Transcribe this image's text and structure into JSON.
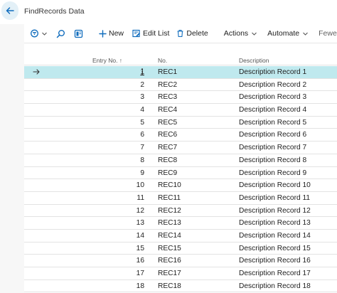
{
  "page": {
    "title": "FindRecords Data"
  },
  "toolbar": {
    "new_label": "New",
    "edit_list_label": "Edit List",
    "delete_label": "Delete",
    "actions_label": "Actions",
    "automate_label": "Automate",
    "fewer_options_label": "Fewer options"
  },
  "table": {
    "headers": {
      "entry_no": "Entry No. ↑",
      "no": "No.",
      "description": "Description"
    },
    "rows": [
      {
        "entry": "1",
        "no": "REC1",
        "desc": "Description Record 1"
      },
      {
        "entry": "2",
        "no": "REC2",
        "desc": "Description Record 2"
      },
      {
        "entry": "3",
        "no": "REC3",
        "desc": "Description Record 3"
      },
      {
        "entry": "4",
        "no": "REC4",
        "desc": "Description Record 4"
      },
      {
        "entry": "5",
        "no": "REC5",
        "desc": "Description Record 5"
      },
      {
        "entry": "6",
        "no": "REC6",
        "desc": "Description Record 6"
      },
      {
        "entry": "7",
        "no": "REC7",
        "desc": "Description Record 7"
      },
      {
        "entry": "8",
        "no": "REC8",
        "desc": "Description Record 8"
      },
      {
        "entry": "9",
        "no": "REC9",
        "desc": "Description Record 9"
      },
      {
        "entry": "10",
        "no": "REC10",
        "desc": "Description Record 10"
      },
      {
        "entry": "11",
        "no": "REC11",
        "desc": "Description Record 11"
      },
      {
        "entry": "12",
        "no": "REC12",
        "desc": "Description Record 12"
      },
      {
        "entry": "13",
        "no": "REC13",
        "desc": "Description Record 13"
      },
      {
        "entry": "14",
        "no": "REC14",
        "desc": "Description Record 14"
      },
      {
        "entry": "15",
        "no": "REC15",
        "desc": "Description Record 15"
      },
      {
        "entry": "16",
        "no": "REC16",
        "desc": "Description Record 16"
      },
      {
        "entry": "17",
        "no": "REC17",
        "desc": "Description Record 17"
      },
      {
        "entry": "18",
        "no": "REC18",
        "desc": "Description Record 18"
      }
    ]
  },
  "colors": {
    "accent": "#0f6cbd",
    "selected_row": "#bfe9ee",
    "back_button_bg": "#e3f0f7"
  },
  "icons": [
    "back-arrow-icon",
    "filter-icon",
    "search-icon",
    "layout-icon",
    "plus-icon",
    "edit-list-icon",
    "trash-icon",
    "chevron-down-icon",
    "row-arrow-icon",
    "more-dots-icon"
  ]
}
